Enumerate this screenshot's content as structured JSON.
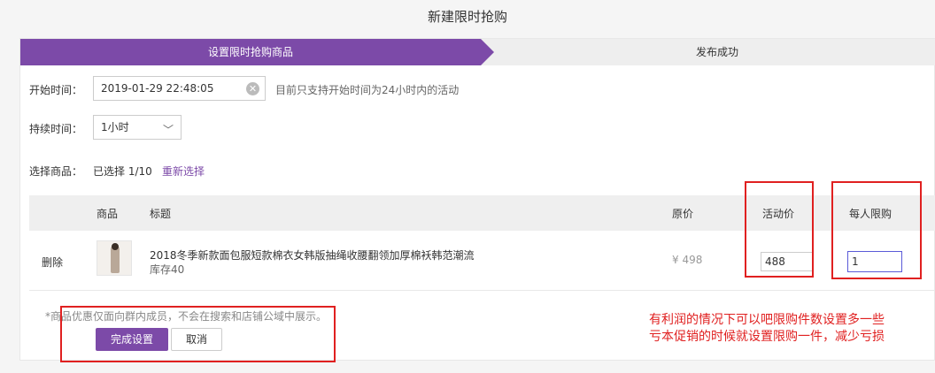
{
  "page": {
    "title": "新建限时抢购"
  },
  "steps": [
    {
      "label": "设置限时抢购商品",
      "active": true
    },
    {
      "label": "发布成功",
      "active": false
    }
  ],
  "form": {
    "start_label": "开始时间：",
    "start_value": "2019-01-29 22:48:05",
    "start_hint": "目前只支持开始时间为24小时内的活动",
    "duration_label": "持续时间：",
    "duration_value": "1小时",
    "goods_label": "选择商品：",
    "selected_text": "已选择  1/10",
    "reselect_label": "重新选择"
  },
  "table": {
    "headers": {
      "goods": "商品",
      "title": "标题",
      "orig_price": "原价",
      "activity_price": "活动价",
      "limit": "每人限购"
    },
    "rows": [
      {
        "action": "删除",
        "title": "2018冬季新款面包服短款棉衣女韩版抽绳收腰翻领加厚棉袄韩范潮流",
        "stock": "库存40",
        "orig_price": "¥ 498",
        "activity_price": "488",
        "limit": "1"
      }
    ]
  },
  "footer": {
    "note": "*商品优惠仅面向群内成员，不会在搜索和店铺公域中展示。",
    "confirm_label": "完成设置",
    "cancel_label": "取消"
  },
  "annotation": {
    "line1": "有利润的情况下可以吧限购件数设置多一些",
    "line2": "亏本促销的时候就设置限购一件，减少亏损"
  },
  "colors": {
    "accent": "#7c4aa8",
    "annotation": "#e02020"
  }
}
